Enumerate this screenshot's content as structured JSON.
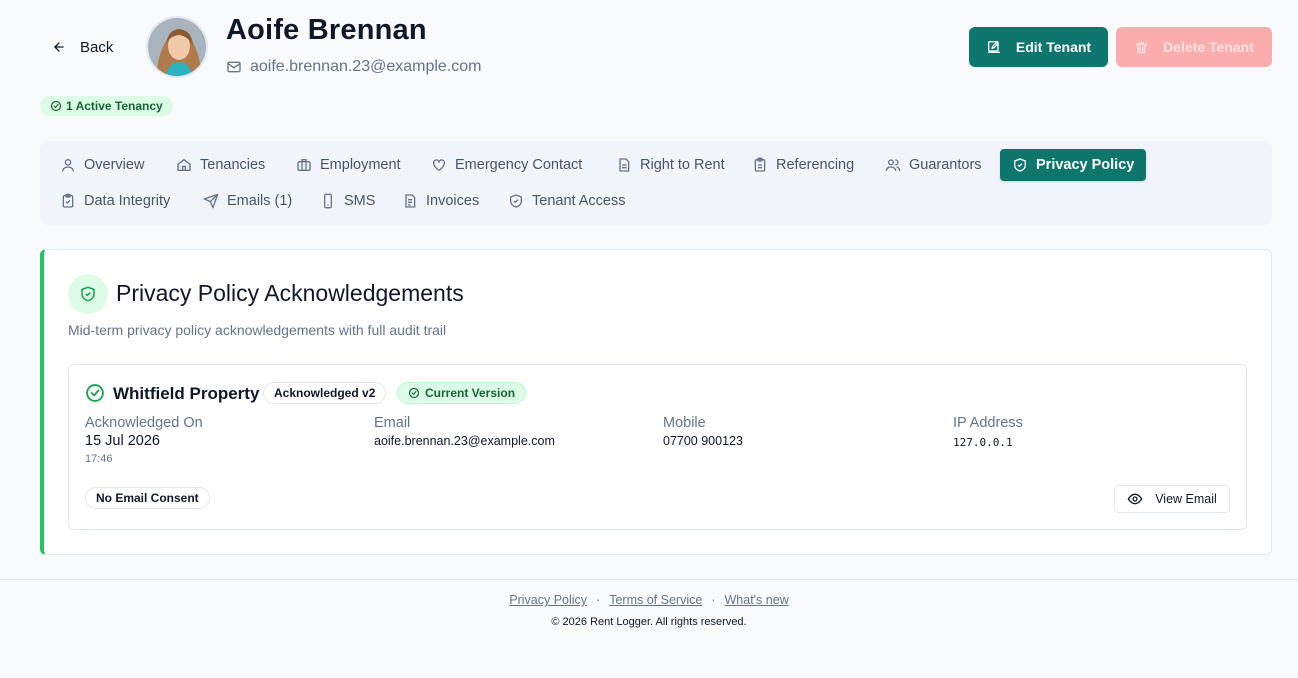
{
  "header": {
    "back_label": "Back",
    "tenant_name": "Aoife Brennan",
    "tenant_email": "aoife.brennan.23@example.com",
    "active_badge": "1 Active Tenancy",
    "edit_label": "Edit Tenant",
    "delete_label": "Delete Tenant"
  },
  "tabs": [
    {
      "label": "Overview",
      "icon": "user-icon"
    },
    {
      "label": "Tenancies",
      "icon": "home-icon"
    },
    {
      "label": "Employment",
      "icon": "briefcase-icon"
    },
    {
      "label": "Emergency Contact",
      "icon": "heart-icon"
    },
    {
      "label": "Right to Rent",
      "icon": "document-icon"
    },
    {
      "label": "Referencing",
      "icon": "clipboard-icon"
    },
    {
      "label": "Guarantors",
      "icon": "users-icon"
    },
    {
      "label": "Privacy Policy",
      "icon": "shield-check-icon",
      "active": true
    },
    {
      "label": "Data Integrity",
      "icon": "clipboard-check-icon"
    },
    {
      "label": "Emails (1)",
      "icon": "send-icon"
    },
    {
      "label": "SMS",
      "icon": "phone-icon"
    },
    {
      "label": "Invoices",
      "icon": "file-text-icon"
    },
    {
      "label": "Tenant Access",
      "icon": "shield-icon"
    }
  ],
  "card": {
    "title": "Privacy Policy Acknowledgements",
    "subtitle": "Mid-term privacy policy acknowledgements with full audit trail",
    "acknowledgement": {
      "property": "Whitfield Property",
      "version_badge": "Acknowledged v2",
      "current_badge": "Current Version",
      "acknowledged_on_label": "Acknowledged On",
      "acknowledged_on_date": "15 Jul 2026",
      "acknowledged_on_time": "17:46",
      "email_label": "Email",
      "email_value": "aoife.brennan.23@example.com",
      "mobile_label": "Mobile",
      "mobile_value": "07700 900123",
      "ip_label": "IP Address",
      "ip_value": "127.0.0.1",
      "consent_badge": "No Email Consent",
      "view_email_label": "View Email"
    }
  },
  "footer": {
    "link_privacy": "Privacy Policy",
    "link_terms": "Terms of Service",
    "link_whats_new": "What's new",
    "separator": "·",
    "copyright": "© 2026 Rent Logger. All rights reserved."
  },
  "colors": {
    "primary": "#0f766e",
    "danger_disabled": "#fca5a5",
    "success": "#22c55e",
    "success_bg": "#dcfce7"
  }
}
